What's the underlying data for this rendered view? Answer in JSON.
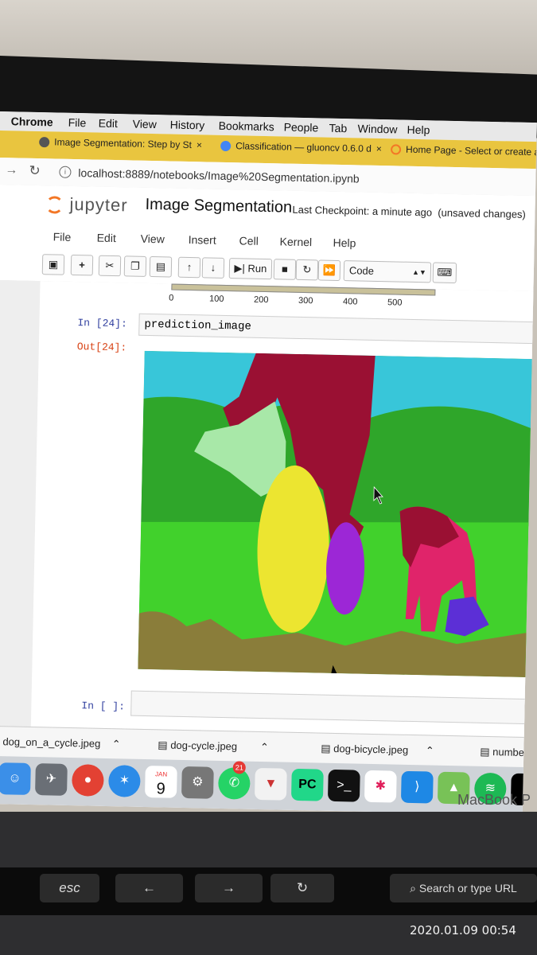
{
  "mac_menu": [
    "Chrome",
    "File",
    "Edit",
    "View",
    "History",
    "Bookmarks",
    "People",
    "Tab",
    "Window",
    "Help"
  ],
  "tabs": [
    {
      "title": "Image Segmentation: Step by St",
      "close": "×"
    },
    {
      "title": "Classification — gluoncv 0.6.0 d",
      "close": "×"
    },
    {
      "title": "Home Page - Select or create a",
      "close": "×"
    }
  ],
  "address": {
    "url": "localhost:8889/notebooks/Image%20Segmentation.ipynb"
  },
  "jupyter": {
    "logo": "jupyter",
    "notebook_title": "Image Segmentation",
    "checkpoint": "Last Checkpoint: a minute ago",
    "status": "(unsaved changes)",
    "menu": [
      "File",
      "Edit",
      "View",
      "Insert",
      "Cell",
      "Kernel",
      "Help"
    ],
    "toolbar": {
      "run_label": "Run",
      "cell_type": "Code"
    },
    "axis_ticks": [
      "0",
      "100",
      "200",
      "300",
      "400",
      "500"
    ],
    "cell_in_prompt": "In [24]:",
    "cell_code": "prediction_image",
    "cell_out_prompt": "Out[24]:",
    "next_prompt": "In [ ]:"
  },
  "downloads": [
    "dog_on_a_cycle.jpeg",
    "dog-cycle.jpeg",
    "dog-bicycle.jpeg",
    "numbe"
  ],
  "dock": {
    "calendar_month": "JAN",
    "calendar_day": "9",
    "whatsapp_badge": "21"
  },
  "touchbar": {
    "esc": "esc",
    "search": "Search or type URL"
  },
  "laptop_brand": "MacBook P",
  "timestamp": "2020.01.09 00:54",
  "colors": {
    "chrome_tab_bar": "#e9c53f",
    "jupyter_orange": "#f37726",
    "prompt_blue": "#303f9f",
    "prompt_red": "#d84315"
  }
}
